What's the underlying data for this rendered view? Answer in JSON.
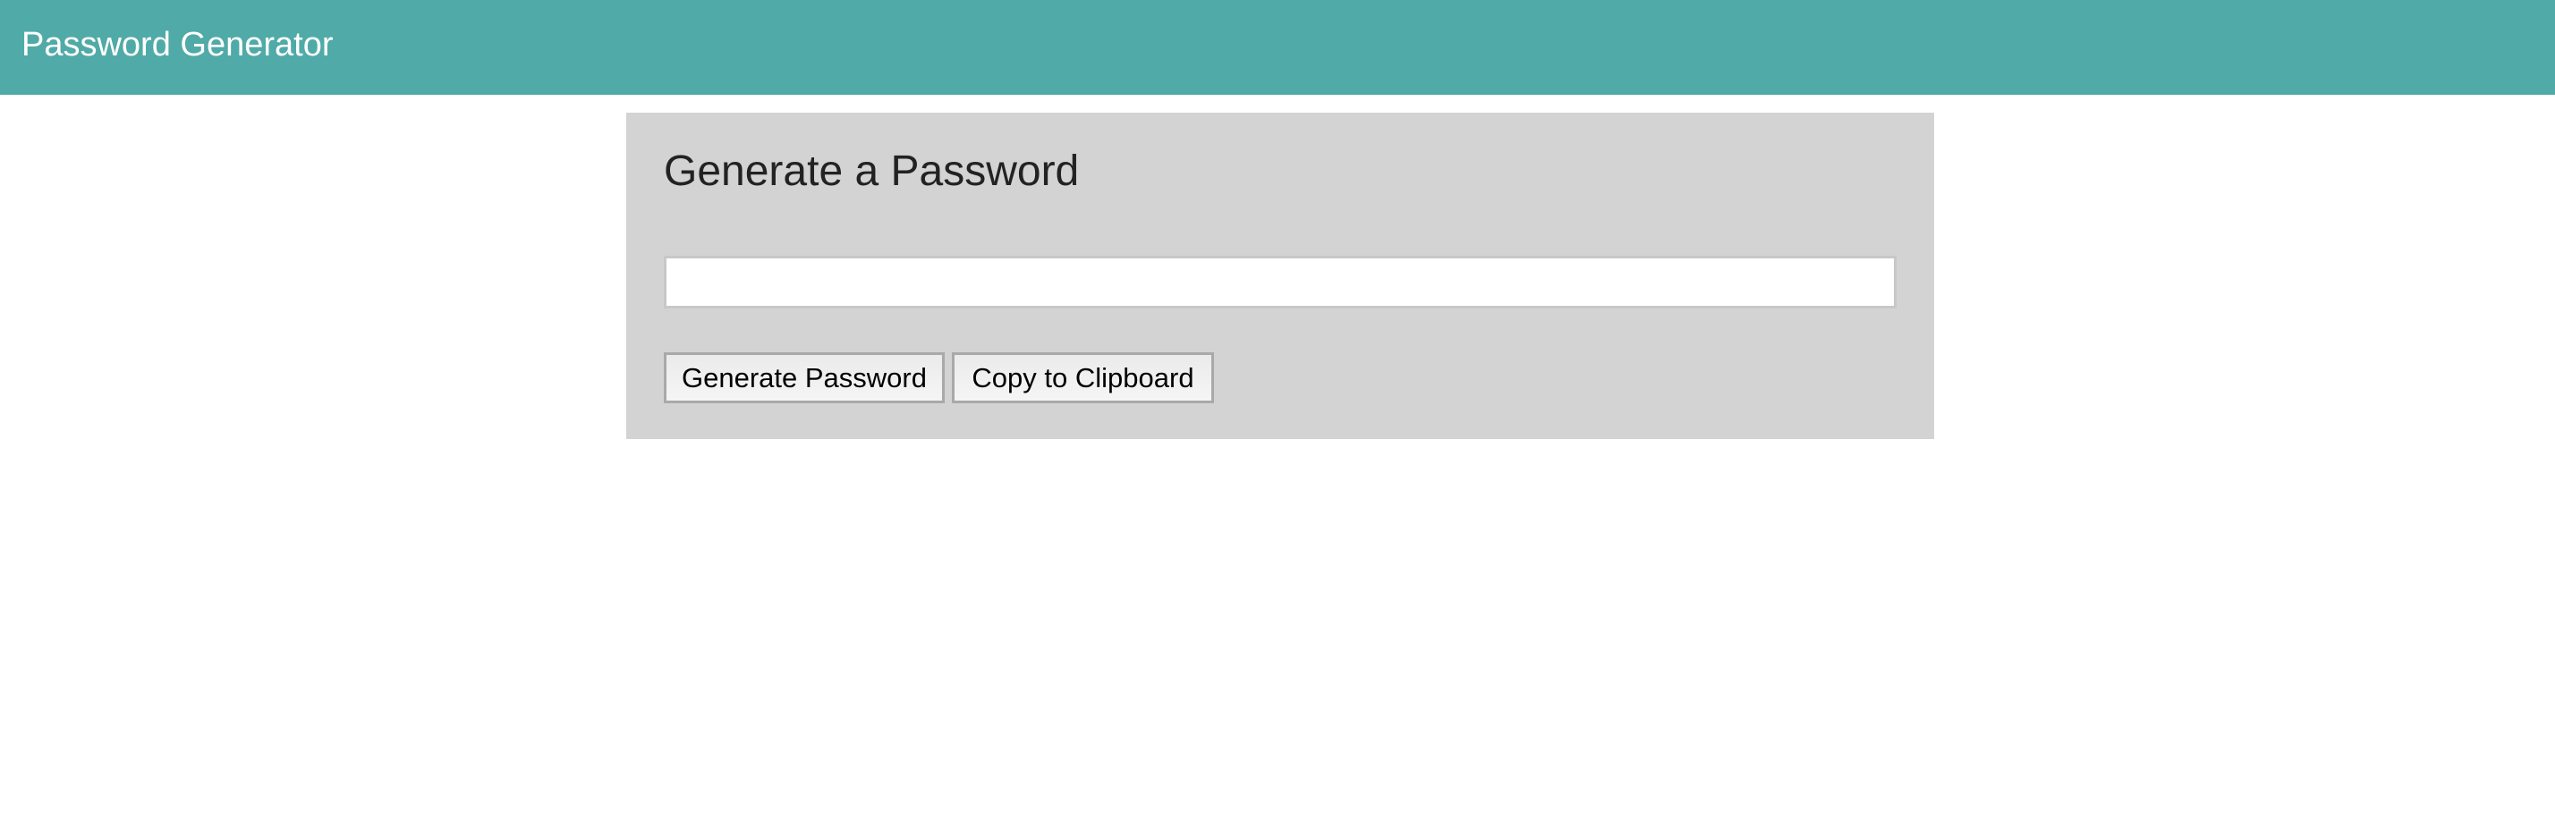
{
  "header": {
    "title": "Password Generator"
  },
  "card": {
    "title": "Generate a Password",
    "password_value": "",
    "generate_label": "Generate Password",
    "copy_label": "Copy to Clipboard"
  },
  "colors": {
    "header_bg": "#50aaa7",
    "card_bg": "#d3d3d3"
  }
}
